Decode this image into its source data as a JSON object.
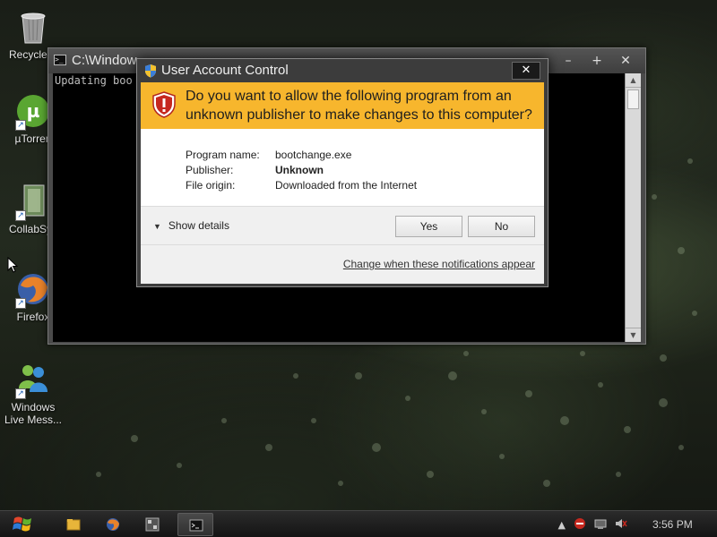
{
  "desktop": {
    "icons": [
      {
        "label": "Recycle B",
        "icon": "recycle-bin-icon"
      },
      {
        "label": "µTorren",
        "icon": "utorrent-icon"
      },
      {
        "label": "CollabSys",
        "icon": "collabsys-icon"
      },
      {
        "label": "Firefox",
        "icon": "firefox-icon"
      },
      {
        "label": "Windows",
        "label2": "Live Mess...",
        "icon": "windows-live-messenger-icon"
      }
    ]
  },
  "console": {
    "title": "C:\\Window",
    "text": "Updating boo",
    "buttons": {
      "minimize": "–",
      "maximize": "+",
      "close": "✕"
    }
  },
  "uac": {
    "title": "User Account Control",
    "close_label": "✕",
    "question": "Do you want to allow the following program from an unknown publisher to make changes to this computer?",
    "program_name_label": "Program name:",
    "program_name": "bootchange.exe",
    "publisher_label": "Publisher:",
    "publisher": "Unknown",
    "file_origin_label": "File origin:",
    "file_origin": "Downloaded from the Internet",
    "show_details": "Show details",
    "yes_label": "Yes",
    "no_label": "No",
    "change_link": "Change when these notifications appear",
    "banner_color": "#f7b62d"
  },
  "taskbar": {
    "clock": "3:56 PM",
    "items": [
      "folder-icon",
      "firefox-icon",
      "app-icon",
      "command-prompt-icon"
    ]
  }
}
